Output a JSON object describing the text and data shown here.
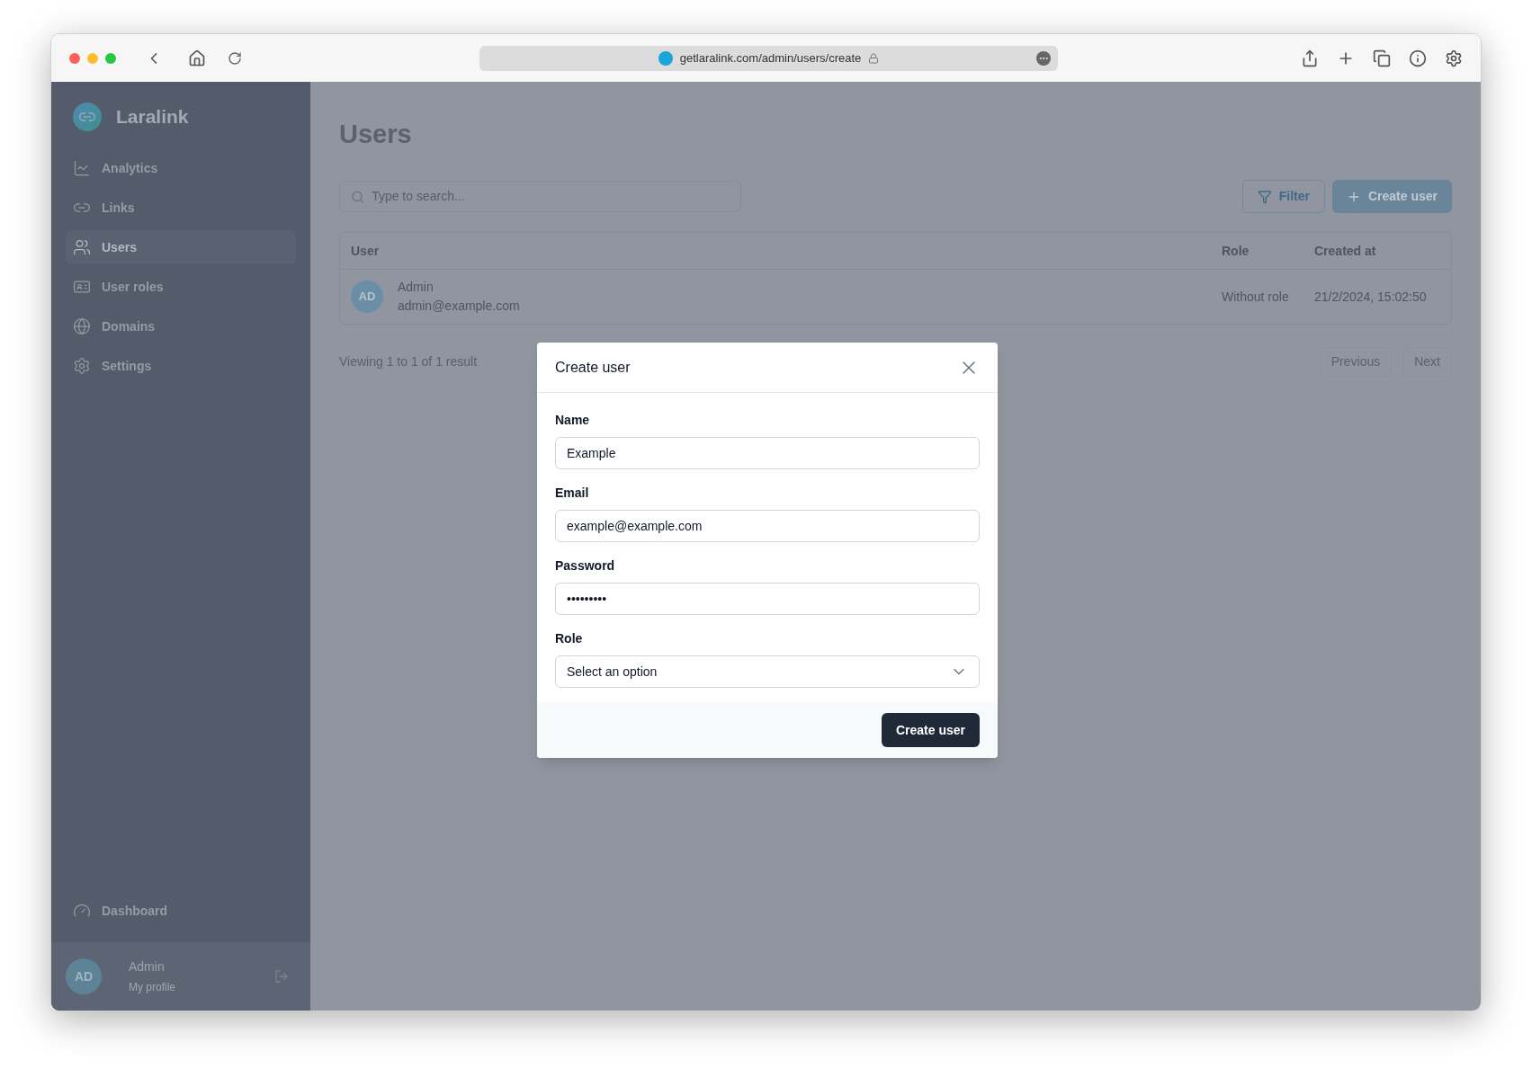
{
  "browser": {
    "url": "getlaralink.com/admin/users/create"
  },
  "sidebar": {
    "brand": "Laralink",
    "items": [
      {
        "label": "Analytics",
        "selected": false
      },
      {
        "label": "Links",
        "selected": false
      },
      {
        "label": "Users",
        "selected": true
      },
      {
        "label": "User roles",
        "selected": false
      },
      {
        "label": "Domains",
        "selected": false
      },
      {
        "label": "Settings",
        "selected": false
      }
    ],
    "bottom_item": {
      "label": "Dashboard"
    },
    "profile": {
      "initials": "AD",
      "name": "Admin",
      "subtitle": "My profile"
    }
  },
  "page": {
    "title": "Users",
    "search": {
      "placeholder": "Type to search..."
    },
    "filter_button": "Filter",
    "create_button": "Create user",
    "table": {
      "columns": [
        "User",
        "Role",
        "Created at"
      ],
      "rows": [
        {
          "initials": "AD",
          "name": "Admin",
          "email": "admin@example.com",
          "role": "Without role",
          "created_at": "21/2/2024, 15:02:50"
        }
      ]
    },
    "summary": "Viewing 1 to 1 of 1 result",
    "pagination": [
      "Previous",
      "Next"
    ]
  },
  "modal": {
    "title": "Create user",
    "fields": [
      {
        "label": "Name",
        "kind": "text",
        "value": "Example"
      },
      {
        "label": "Email",
        "kind": "text",
        "value": "example@example.com"
      },
      {
        "label": "Password",
        "kind": "text",
        "value": "•••••••••"
      },
      {
        "label": "Role",
        "kind": "select",
        "value": "Select an option"
      }
    ],
    "submit": "Create user"
  }
}
